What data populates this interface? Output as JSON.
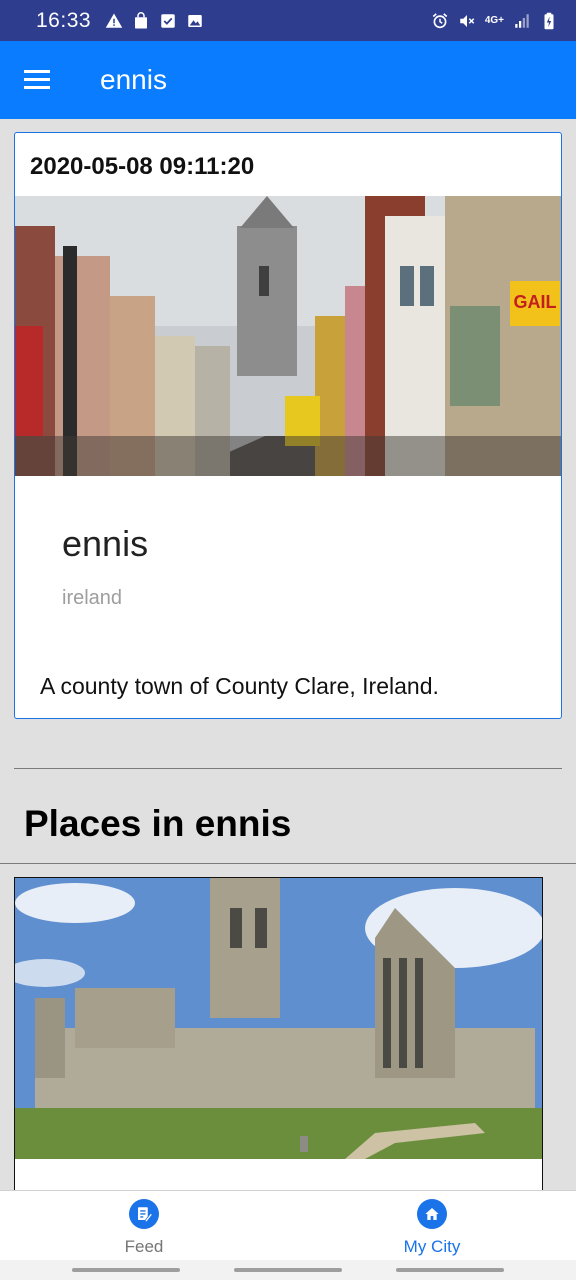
{
  "status_bar": {
    "time": "16:33",
    "network": "4G+",
    "icons_left": [
      "warning-icon",
      "bag-icon",
      "check-box-icon",
      "image-icon"
    ],
    "icons_right": [
      "alarm-icon",
      "mute-icon",
      "network-text",
      "signal-icon",
      "battery-charging-icon"
    ]
  },
  "app_bar": {
    "title": "ennis",
    "menu_icon": "hamburger-menu-icon",
    "background": "#0a7cff"
  },
  "city_card": {
    "timestamp": "2020-05-08 09:11:20",
    "city": "ennis",
    "country": "ireland",
    "description": "A county town of County Clare, Ireland.",
    "photo_sign": "GAIL",
    "border_color": "#1a73e8"
  },
  "places_section": {
    "title": "Places in ennis"
  },
  "bottom_nav": {
    "items": [
      {
        "label": "Feed",
        "icon": "feed-icon",
        "active": false
      },
      {
        "label": "My City",
        "icon": "home-icon",
        "active": true
      }
    ],
    "active_color": "#1a73e8",
    "inactive_color": "#757575"
  }
}
